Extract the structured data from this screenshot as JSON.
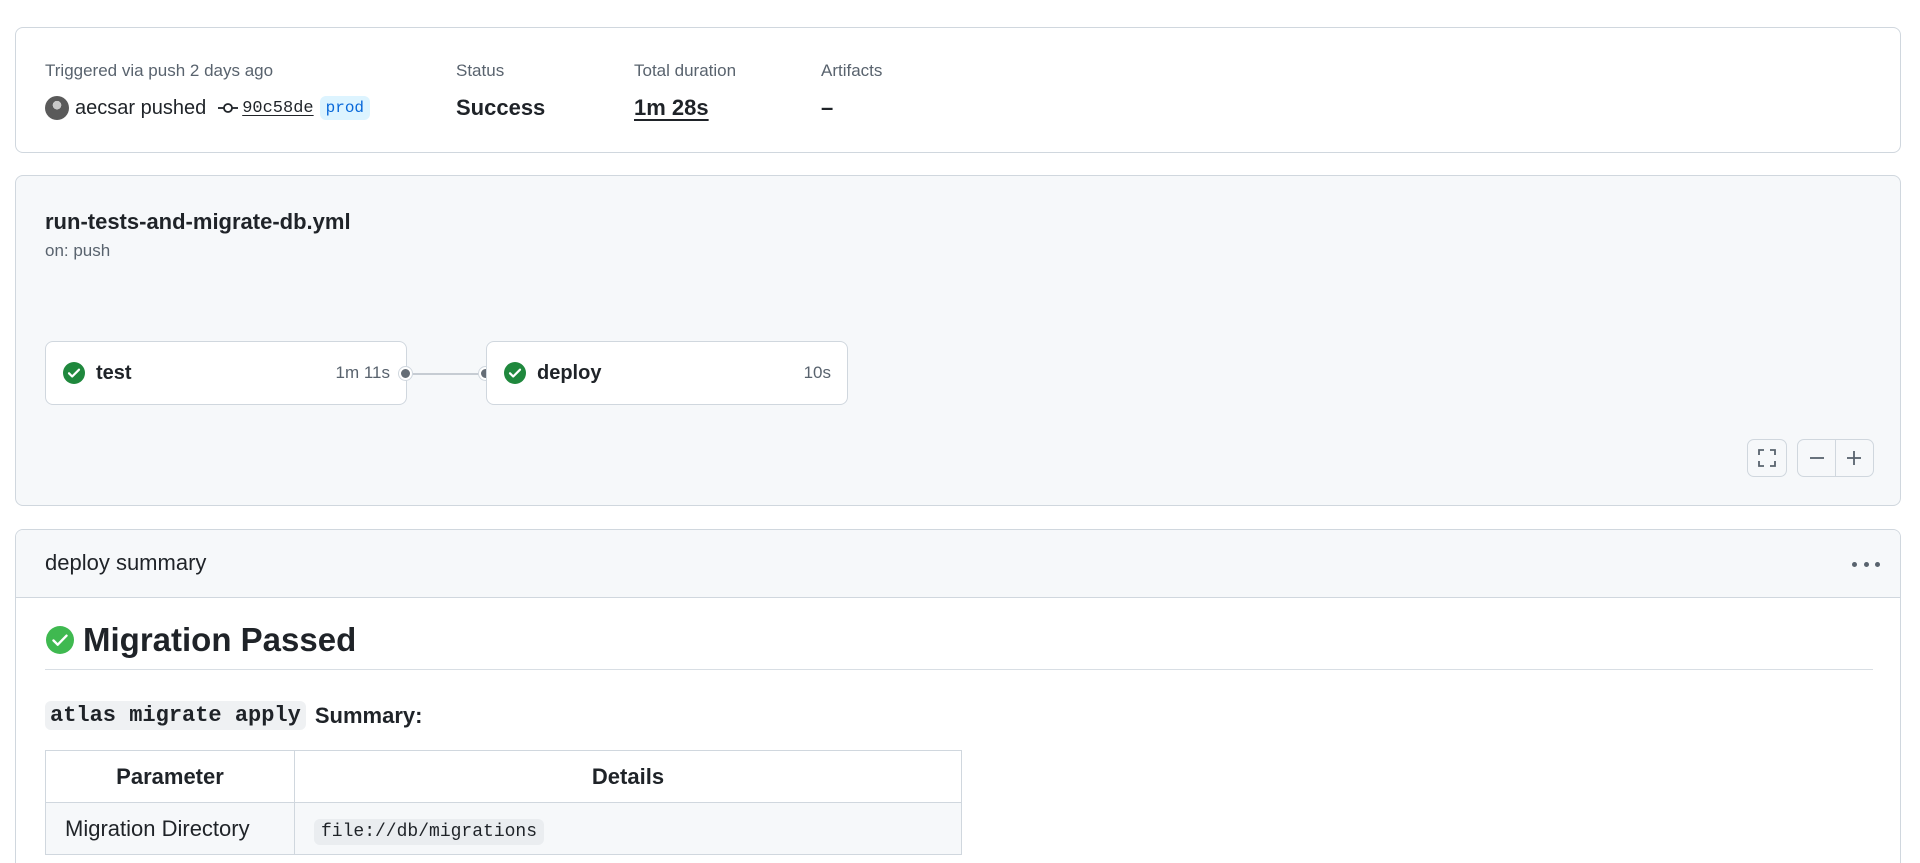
{
  "summary": {
    "trigger_label": "Triggered via push 2 days ago",
    "actor": "aecsar pushed",
    "commit_sha": "90c58de",
    "branch": "prod",
    "status_label": "Status",
    "status_value": "Success",
    "duration_label": "Total duration",
    "duration_value": "1m 28s",
    "artifacts_label": "Artifacts",
    "artifacts_value": "–"
  },
  "workflow": {
    "file": "run-tests-and-migrate-db.yml",
    "trigger": "on: push",
    "jobs": [
      {
        "name": "test",
        "duration": "1m 11s",
        "status": "success"
      },
      {
        "name": "deploy",
        "duration": "10s",
        "status": "success"
      }
    ],
    "controls": [
      "fullscreen-icon",
      "zoom-out-icon",
      "zoom-in-icon"
    ]
  },
  "job_summary": {
    "header": "deploy summary",
    "heading": "Migration Passed",
    "subheading_code": "atlas migrate apply",
    "subheading_text": "Summary:",
    "table": {
      "headers": [
        "Parameter",
        "Details"
      ],
      "rows": [
        {
          "parameter": "Migration Directory",
          "details": "file://db/migrations"
        }
      ]
    }
  },
  "colors": {
    "success": "#1f883d",
    "success_light": "#3fb950",
    "link_badge_bg": "#ddf4ff",
    "link_badge_fg": "#0969da",
    "border": "#d0d7de",
    "muted": "#59636e"
  }
}
